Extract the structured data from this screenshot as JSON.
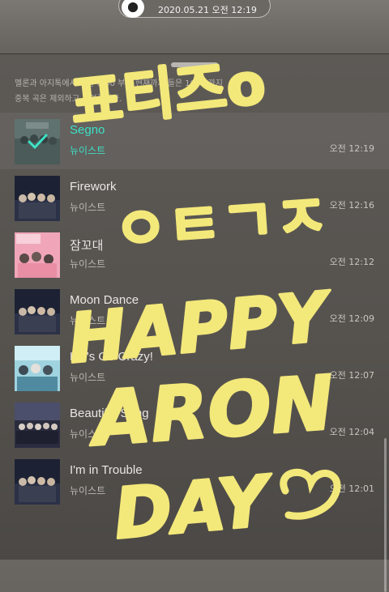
{
  "status": {
    "datetime": "2020.05.21 오전 12:19"
  },
  "notice": {
    "line1": "멜론과 아지톡에서 오늘 0:00 부터 현재까지 들은 100곡까지",
    "line2": "중복 곡은 제외하고 보여줍니다."
  },
  "songs": [
    {
      "title": "Segno",
      "artist": "뉴이스트",
      "time": "오전 12:19",
      "cover": "cover-check"
    },
    {
      "title": "Firework",
      "artist": "뉴이스트",
      "time": "오전 12:16",
      "cover": "cover-dark-group"
    },
    {
      "title": "잠꼬대",
      "artist": "뉴이스트",
      "time": "오전 12:12",
      "cover": "cover-pink-group"
    },
    {
      "title": "Moon Dance",
      "artist": "뉴이스트",
      "time": "오전 12:09",
      "cover": "cover-dark-group"
    },
    {
      "title": "Let's Go Crazy!",
      "artist": "뉴이스트",
      "time": "오전 12:07",
      "cover": "cover-teal-group"
    },
    {
      "title": "Beautiful Song",
      "artist": "뉴이스트",
      "time": "오전 12:04",
      "cover": "cover-night-group"
    },
    {
      "title": "I'm in Trouble",
      "artist": "뉴이스트",
      "time": "오전 12:01",
      "cover": "cover-dark-group"
    }
  ],
  "handwriting": {
    "line1": "표티즈o",
    "line2": "ㅇㅌㄱㅈ",
    "line3": "HAPPY",
    "line4": "ARON",
    "line5": "DAY",
    "heart_icon": "heart-doodle"
  },
  "colors": {
    "accent": "#3ce2c6",
    "doodle": "#f3e87a"
  }
}
